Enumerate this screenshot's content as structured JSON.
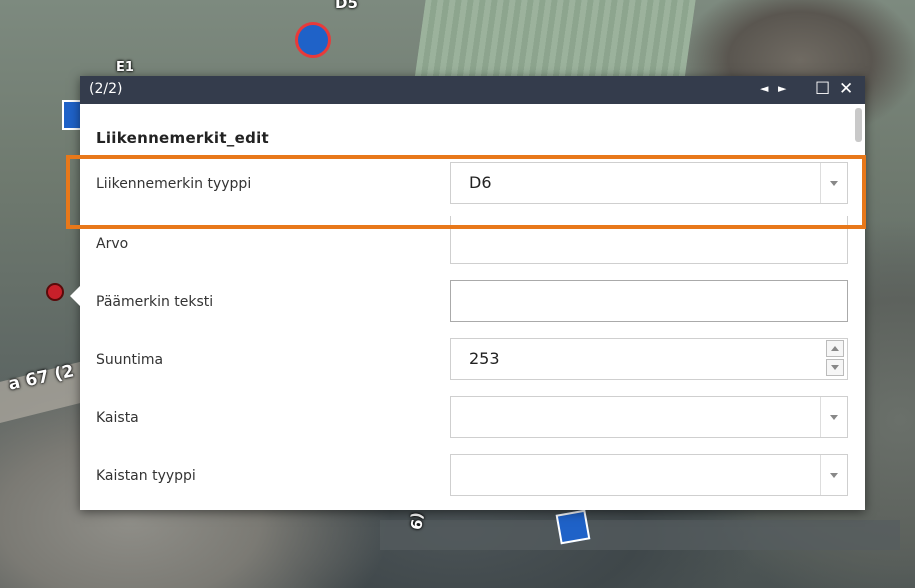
{
  "map": {
    "labels": {
      "road_label": "a 67 (2",
      "top_label": "D5",
      "left_label": "E1",
      "bottom_label": "(9"
    },
    "colors": {
      "sign_blue": "#1f62c8",
      "marker_red": "#c8202a"
    }
  },
  "popup": {
    "counter": "(2/2)",
    "controls": {
      "prev_icon": "◄",
      "next_icon": "►",
      "maximize_icon": "☐",
      "close_icon": "✕"
    },
    "layer_title": "Liikennemerkit_edit",
    "fields": [
      {
        "label": "Liikennemerkin tyyppi",
        "value": "D6",
        "type": "select"
      },
      {
        "label": "Arvo",
        "value": "",
        "type": "text"
      },
      {
        "label": "Päämerkin teksti",
        "value": "",
        "type": "text"
      },
      {
        "label": "Suuntima",
        "value": "253",
        "type": "number"
      },
      {
        "label": "Kaista",
        "value": "",
        "type": "select"
      },
      {
        "label": "Kaistan tyyppi",
        "value": "",
        "type": "select"
      }
    ]
  },
  "highlight_color": "#e8781a"
}
